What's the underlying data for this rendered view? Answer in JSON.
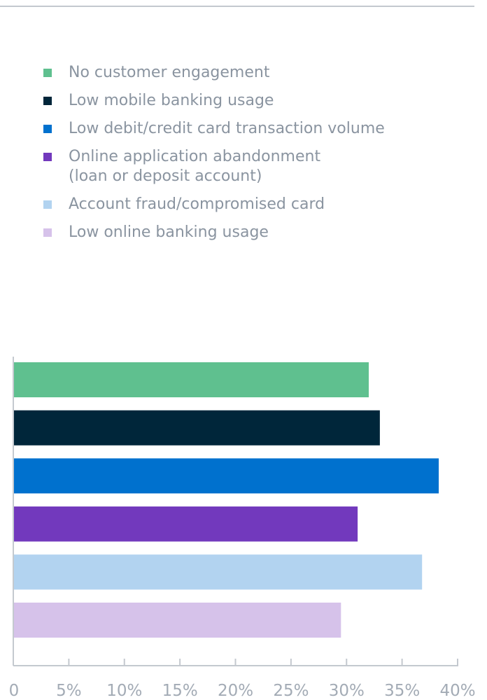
{
  "chart_data": {
    "type": "bar",
    "orientation": "horizontal",
    "categories": [
      "No customer engagement",
      "Low mobile banking usage",
      "Low debit/credit card transaction volume",
      "Online application abandonment\n(loan or deposit account)",
      "Account fraud/compromised card",
      "Low online banking usage"
    ],
    "values": [
      32,
      33,
      38.3,
      31,
      36.8,
      29.5
    ],
    "colors": [
      "#5fc08f",
      "#00263a",
      "#0071ce",
      "#7239bd",
      "#b2d3f0",
      "#d6c2ea"
    ],
    "xlim": [
      0,
      40
    ],
    "xticks": [
      0,
      5,
      10,
      15,
      20,
      25,
      30,
      35,
      40
    ],
    "xtick_labels": [
      "0",
      "5%",
      "10%",
      "15%",
      "20%",
      "25%",
      "30%",
      "35%",
      "40%"
    ],
    "legend_position": "top",
    "grid": false
  }
}
